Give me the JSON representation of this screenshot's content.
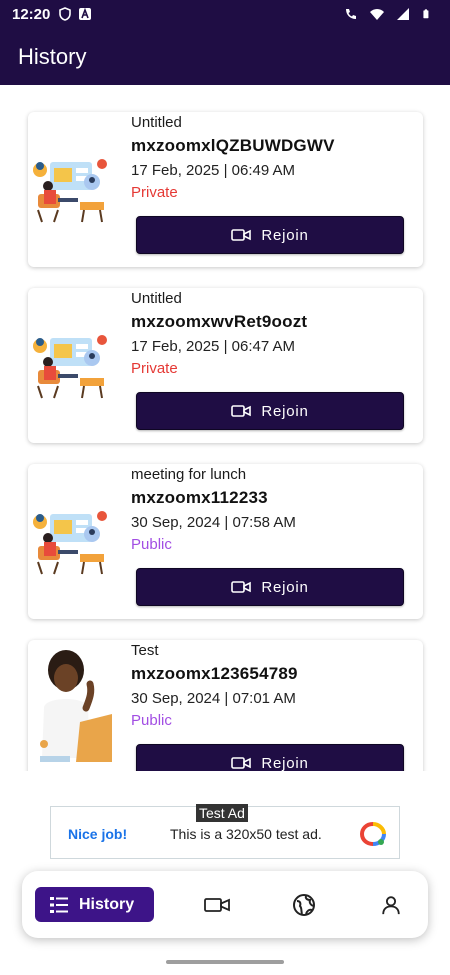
{
  "status_bar": {
    "time": "12:20"
  },
  "app_bar": {
    "title": "History"
  },
  "meetings": [
    {
      "title": "Untitled",
      "room": "mxzoomxlQZBUWDGWV",
      "datetime": "17 Feb, 2025 | 06:49 AM",
      "visibility": "Private",
      "button": "Rejoin",
      "thumb": "meeting-illustration"
    },
    {
      "title": "Untitled",
      "room": "mxzoomxwvRet9oozt",
      "datetime": "17 Feb, 2025 | 06:47 AM",
      "visibility": "Private",
      "button": "Rejoin",
      "thumb": "meeting-illustration"
    },
    {
      "title": "meeting for lunch",
      "room": "mxzoomx112233",
      "datetime": "30 Sep, 2024 | 07:58 AM",
      "visibility": "Public",
      "button": "Rejoin",
      "thumb": "meeting-illustration"
    },
    {
      "title": "Test",
      "room": "mxzoomx123654789",
      "datetime": "30 Sep, 2024 | 07:01 AM",
      "visibility": "Public",
      "button": "Rejoin",
      "thumb": "person-at-laptop"
    }
  ],
  "ad": {
    "tag": "Test Ad",
    "headline": "Nice job!",
    "message": "This is a 320x50 test ad."
  },
  "bottom_nav": {
    "items": [
      {
        "label": "History",
        "icon": "list-icon",
        "active": true
      },
      {
        "label": "",
        "icon": "video-icon",
        "active": false
      },
      {
        "label": "",
        "icon": "globe-icon",
        "active": false
      },
      {
        "label": "",
        "icon": "person-icon",
        "active": false
      }
    ]
  },
  "colors": {
    "primary": "#1f0d44",
    "active_tab": "#3d1488",
    "private": "#e53935",
    "public": "#a24ee3"
  }
}
